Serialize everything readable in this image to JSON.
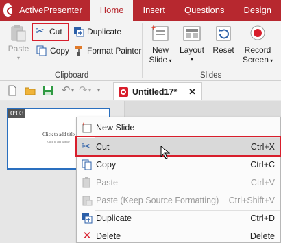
{
  "app": {
    "name": "ActivePresenter"
  },
  "tabs": [
    "Home",
    "Insert",
    "Questions",
    "Design"
  ],
  "ribbon": {
    "clipboard": {
      "label": "Clipboard",
      "paste": "Paste",
      "cut": "Cut",
      "copy": "Copy",
      "duplicate": "Duplicate",
      "format_painter": "Format Painter"
    },
    "slides": {
      "label": "Slides",
      "new_slide_1": "New",
      "new_slide_2": "Slide",
      "layout": "Layout",
      "reset": "Reset",
      "record_1": "Record",
      "record_2": "Screen"
    }
  },
  "document_tab": {
    "title": "Untitled17*",
    "close": "✕"
  },
  "slide": {
    "time": "0:03",
    "title_placeholder": "Click to add title",
    "subtitle_placeholder": "Click to add subtitle"
  },
  "context_menu": {
    "items": [
      {
        "label": "New Slide",
        "shortcut": "",
        "icon": "new-slide-icon"
      },
      {
        "label": "Cut",
        "shortcut": "Ctrl+X",
        "icon": "cut-icon"
      },
      {
        "label": "Copy",
        "shortcut": "Ctrl+C",
        "icon": "copy-icon"
      },
      {
        "label": "Paste",
        "shortcut": "Ctrl+V",
        "icon": "paste-icon"
      },
      {
        "label": "Paste (Keep Source Formatting)",
        "shortcut": "Ctrl+Shift+V",
        "icon": "paste-keep-icon"
      },
      {
        "label": "Duplicate",
        "shortcut": "Ctrl+D",
        "icon": "duplicate-icon"
      },
      {
        "label": "Delete",
        "shortcut": "Delete",
        "icon": "delete-icon"
      }
    ]
  },
  "colors": {
    "brand": "#b7282f",
    "highlight": "#d81e2c",
    "selection": "#2a6fbf"
  }
}
